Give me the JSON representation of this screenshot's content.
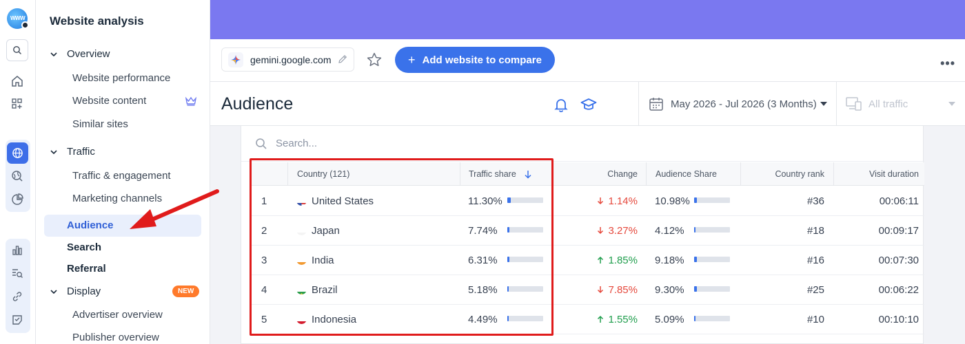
{
  "rail": {
    "logo_text": "WWW"
  },
  "nav": {
    "title": "Website analysis",
    "overview": {
      "label": "Overview",
      "items": [
        "Website performance",
        "Website content",
        "Similar sites"
      ]
    },
    "traffic": {
      "label": "Traffic",
      "items": [
        "Traffic & engagement",
        "Marketing channels"
      ]
    },
    "active_item": "Audience",
    "search": "Search",
    "referral": "Referral",
    "display": {
      "label": "Display",
      "badge": "NEW",
      "items": [
        "Advertiser overview",
        "Publisher overview"
      ]
    }
  },
  "toolbar": {
    "domain": "gemini.google.com",
    "add_button": "Add website to compare",
    "more": "•••"
  },
  "header": {
    "title": "Audience",
    "date_range": "May 2026 - Jul 2026 (3 Months)",
    "traffic_filter": "All traffic"
  },
  "search": {
    "placeholder": "Search..."
  },
  "table": {
    "headers": {
      "country": "Country (121)",
      "traffic_share": "Traffic share",
      "change": "Change",
      "audience_share": "Audience Share",
      "country_rank": "Country rank",
      "visit_duration": "Visit duration"
    },
    "rows": [
      {
        "rank": "1",
        "country": "United States",
        "flag": "us",
        "traffic_share": "11.30%",
        "traffic_fill": 0.113,
        "change": "1.14%",
        "change_dir": "down",
        "audience_share": "10.98%",
        "audience_fill": 0.1098,
        "country_rank": "#36",
        "visit_duration": "00:06:11"
      },
      {
        "rank": "2",
        "country": "Japan",
        "flag": "jp",
        "traffic_share": "7.74%",
        "traffic_fill": 0.0774,
        "change": "3.27%",
        "change_dir": "down",
        "audience_share": "4.12%",
        "audience_fill": 0.0412,
        "country_rank": "#18",
        "visit_duration": "00:09:17"
      },
      {
        "rank": "3",
        "country": "India",
        "flag": "in",
        "traffic_share": "6.31%",
        "traffic_fill": 0.0631,
        "change": "1.85%",
        "change_dir": "up",
        "audience_share": "9.18%",
        "audience_fill": 0.0918,
        "country_rank": "#16",
        "visit_duration": "00:07:30"
      },
      {
        "rank": "4",
        "country": "Brazil",
        "flag": "br",
        "traffic_share": "5.18%",
        "traffic_fill": 0.0518,
        "change": "7.85%",
        "change_dir": "down",
        "audience_share": "9.30%",
        "audience_fill": 0.093,
        "country_rank": "#25",
        "visit_duration": "00:06:22"
      },
      {
        "rank": "5",
        "country": "Indonesia",
        "flag": "id",
        "traffic_share": "4.49%",
        "traffic_fill": 0.0449,
        "change": "1.55%",
        "change_dir": "up",
        "audience_share": "5.09%",
        "audience_fill": 0.0509,
        "country_rank": "#10",
        "visit_duration": "00:10:10"
      }
    ]
  },
  "colors": {
    "banner": "#7a78f0",
    "accent": "#3a72ea",
    "down": "#e5483c",
    "up": "#1f9d4c",
    "highlight": "#e01b1b",
    "badge": "#ff7a2b"
  },
  "icons": [
    "search-icon",
    "home-icon",
    "apps-add-icon",
    "globe-icon",
    "globe-search-icon",
    "pie-chart-icon",
    "bar-chart-icon",
    "list-search-icon",
    "link-icon",
    "check-doc-icon",
    "crown-icon",
    "pencil-icon",
    "star-icon",
    "bell-icon",
    "graduation-cap-icon",
    "calendar-icon",
    "devices-icon",
    "sort-down-icon",
    "arrow-down-icon",
    "arrow-up-icon",
    "annotation-arrow"
  ]
}
